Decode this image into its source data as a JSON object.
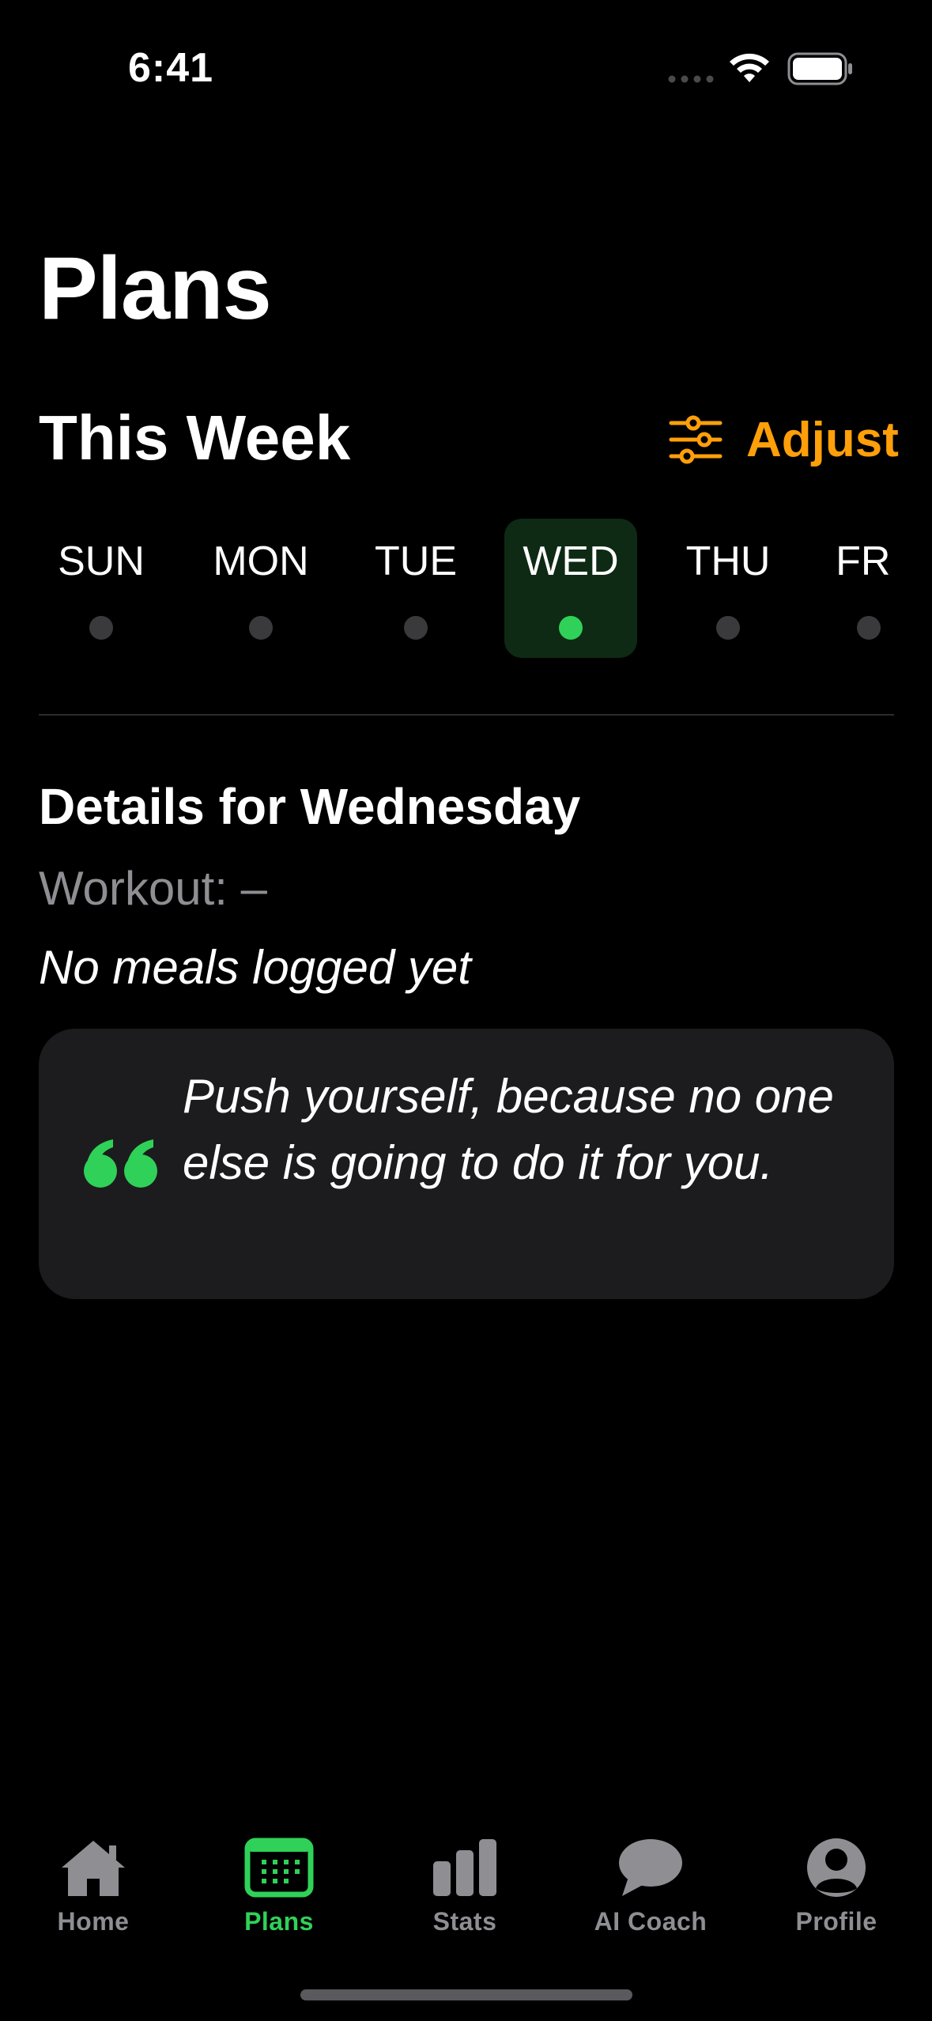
{
  "status_bar": {
    "time": "6:41"
  },
  "page": {
    "title": "Plans"
  },
  "week": {
    "title": "This Week",
    "adjust_label": "Adjust",
    "days": [
      {
        "label": "SUN",
        "selected": false
      },
      {
        "label": "MON",
        "selected": false
      },
      {
        "label": "TUE",
        "selected": false
      },
      {
        "label": "WED",
        "selected": true
      },
      {
        "label": "THU",
        "selected": false
      },
      {
        "label": "FRI",
        "selected": false
      }
    ]
  },
  "details": {
    "title": "Details for Wednesday",
    "workout": "Workout: –",
    "meals": "No meals logged yet"
  },
  "quote": {
    "text": "Push yourself, because no one else is going to do it for you."
  },
  "tab_bar": {
    "tabs": [
      {
        "label": "Home",
        "icon": "house-icon",
        "active": false
      },
      {
        "label": "Plans",
        "icon": "calendar-icon",
        "active": true
      },
      {
        "label": "Stats",
        "icon": "chart-bar-icon",
        "active": false
      },
      {
        "label": "AI Coach",
        "icon": "chat-bubble-icon",
        "active": false
      },
      {
        "label": "Profile",
        "icon": "person-circle-icon",
        "active": false
      }
    ]
  },
  "colors": {
    "accent_green": "#30D158",
    "accent_orange": "#FF9F0A",
    "selected_day_bg": "#0E2A14",
    "card_bg": "#1C1C1E",
    "secondary_text": "#8E8E93"
  }
}
